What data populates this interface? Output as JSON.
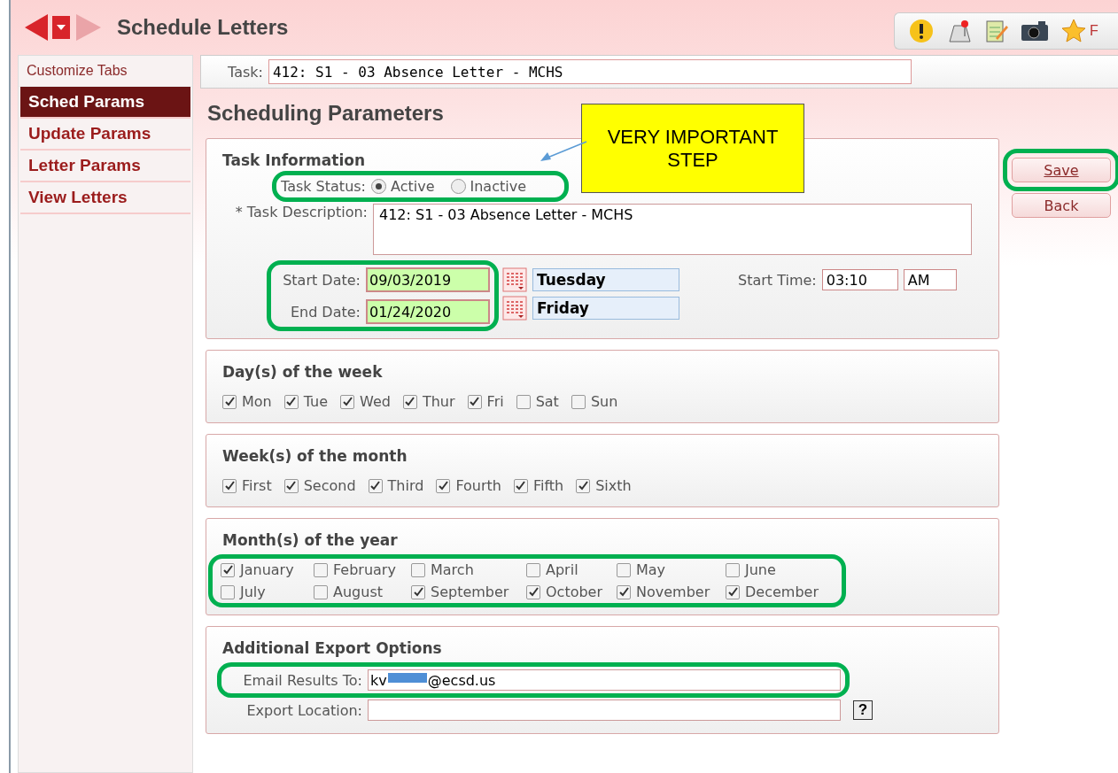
{
  "window": {
    "title": "Schedule Letters",
    "toolbar_label": "F"
  },
  "sidebar": {
    "header": "Customize Tabs",
    "items": [
      {
        "label": "Sched Params",
        "selected": true
      },
      {
        "label": "Update Params",
        "selected": false
      },
      {
        "label": "Letter Params",
        "selected": false
      },
      {
        "label": "View Letters",
        "selected": false
      }
    ]
  },
  "task_bar": {
    "label": "Task:",
    "value": "412: S1 - 03 Absence Letter - MCHS"
  },
  "heading": "Scheduling Parameters",
  "buttons": [
    {
      "label": "Save",
      "kind": "primary"
    },
    {
      "label": "Back",
      "kind": "secondary"
    }
  ],
  "task_information": {
    "title": "Task Information",
    "status_label": "Task Status:",
    "status_options": [
      {
        "label": "Active",
        "selected": true
      },
      {
        "label": "Inactive",
        "selected": false
      }
    ],
    "description_label": "* Task Description:",
    "description": "412: S1 - 03 Absence Letter - MCHS",
    "start_date_label": "Start Date:",
    "start_date": "09/03/2019",
    "start_day": "Tuesday",
    "end_date_label": "End Date:",
    "end_date": "01/24/2020",
    "end_day": "Friday",
    "start_time_label": "Start Time:",
    "start_time": "03:10",
    "ampm": "AM"
  },
  "days": {
    "title": "Day(s) of the week",
    "items": [
      {
        "label": "Mon",
        "checked": true
      },
      {
        "label": "Tue",
        "checked": true
      },
      {
        "label": "Wed",
        "checked": true
      },
      {
        "label": "Thur",
        "checked": true
      },
      {
        "label": "Fri",
        "checked": true
      },
      {
        "label": "Sat",
        "checked": false
      },
      {
        "label": "Sun",
        "checked": false
      }
    ]
  },
  "weeks": {
    "title": "Week(s) of the month",
    "items": [
      {
        "label": "First",
        "checked": true
      },
      {
        "label": "Second",
        "checked": true
      },
      {
        "label": "Third",
        "checked": true
      },
      {
        "label": "Fourth",
        "checked": true
      },
      {
        "label": "Fifth",
        "checked": true
      },
      {
        "label": "Sixth",
        "checked": true
      }
    ]
  },
  "months": {
    "title": "Month(s) of the year",
    "items": [
      {
        "label": "January",
        "checked": true
      },
      {
        "label": "February",
        "checked": false
      },
      {
        "label": "March",
        "checked": false
      },
      {
        "label": "April",
        "checked": false
      },
      {
        "label": "May",
        "checked": false
      },
      {
        "label": "June",
        "checked": false
      },
      {
        "label": "July",
        "checked": false
      },
      {
        "label": "August",
        "checked": false
      },
      {
        "label": "September",
        "checked": true
      },
      {
        "label": "October",
        "checked": true
      },
      {
        "label": "November",
        "checked": true
      },
      {
        "label": "December",
        "checked": true
      }
    ]
  },
  "export": {
    "title": "Additional Export Options",
    "email_label": "Email Results To:",
    "email_prefix": "kv",
    "email_suffix": "@ecsd.us",
    "email_redacted": true,
    "location_label": "Export Location:",
    "help": "?"
  },
  "callout": {
    "text": "VERY IMPORTANT STEP"
  }
}
